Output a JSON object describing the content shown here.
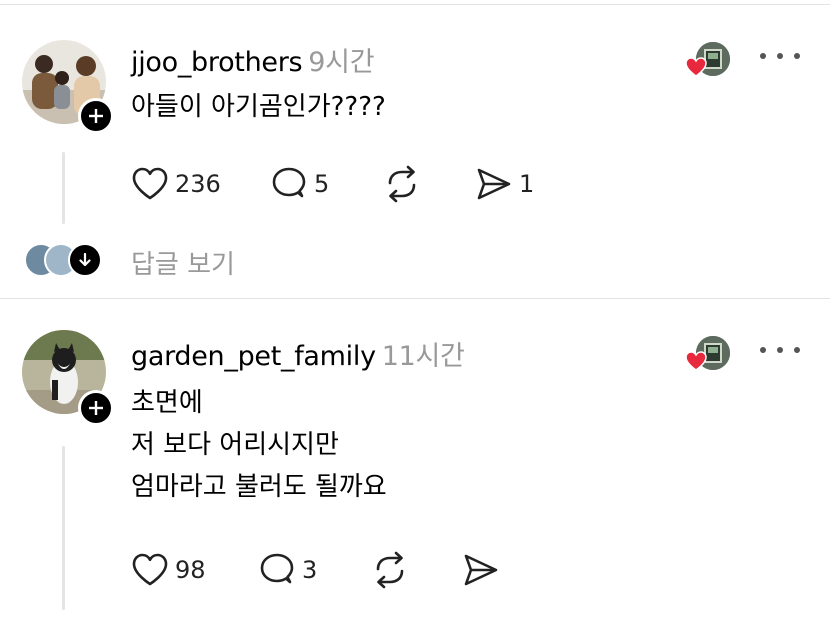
{
  "posts": [
    {
      "username": "jjoo_brothers",
      "time": "9시간",
      "lines": [
        "아들이 아기곰인가????"
      ],
      "likes": "236",
      "comments": "5",
      "shares": "1"
    },
    {
      "username": "garden_pet_family",
      "time": "11시간",
      "lines": [
        "초면에",
        "저 보다 어리시지만",
        "엄마라고 불러도 될까요"
      ],
      "likes": "98",
      "comments": "3",
      "shares": ""
    }
  ],
  "replies": {
    "label": "답글 보기"
  },
  "colors": {
    "heart": "#e8283c",
    "muted": "#999999",
    "divider": "#e3e3e3"
  },
  "icons": [
    "heart-icon",
    "comment-icon",
    "repost-icon",
    "share-icon",
    "more-icon",
    "plus-icon",
    "arrow-down-icon"
  ]
}
